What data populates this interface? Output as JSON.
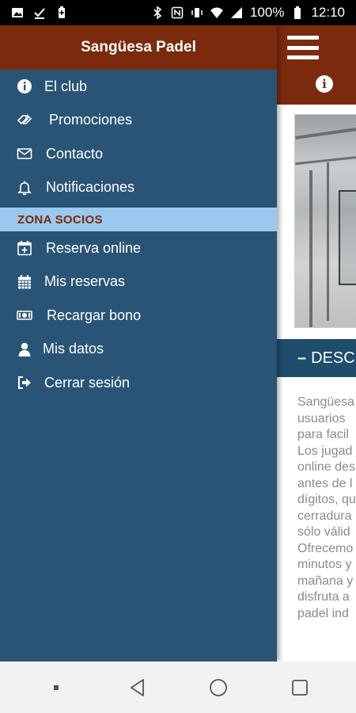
{
  "status_bar": {
    "battery_percent": "100%",
    "time": "12:10"
  },
  "drawer": {
    "title": "Sangüesa Padel",
    "items": [
      {
        "label": "El club",
        "icon": "info-icon"
      },
      {
        "label": "Promociones",
        "icon": "tag-icon"
      },
      {
        "label": "Contacto",
        "icon": "envelope-icon"
      },
      {
        "label": "Notificaciones",
        "icon": "bell-icon"
      }
    ],
    "section_label": "ZONA SOCIOS",
    "member_items": [
      {
        "label": "Reserva online",
        "icon": "calendar-plus-icon"
      },
      {
        "label": "Mis reservas",
        "icon": "calendar-icon"
      },
      {
        "label": "Recargar bono",
        "icon": "money-icon"
      },
      {
        "label": "Mis datos",
        "icon": "user-icon"
      },
      {
        "label": "Cerrar sesión",
        "icon": "logout-icon"
      }
    ]
  },
  "background": {
    "section_title": "DESC",
    "text_lines": [
      "Sangüesa",
      "usuarios",
      "para facil",
      "Los jugad",
      "online des",
      "antes de l",
      "dígitos, qu",
      "cerradura",
      "sólo válid",
      "Ofrecemo",
      "minutos y",
      "mañana y",
      "disfruta a",
      "padel ind"
    ]
  },
  "colors": {
    "brand_red": "#7c2a0d",
    "drawer_blue": "#2a5475",
    "section_blue": "#9ac8ee"
  }
}
